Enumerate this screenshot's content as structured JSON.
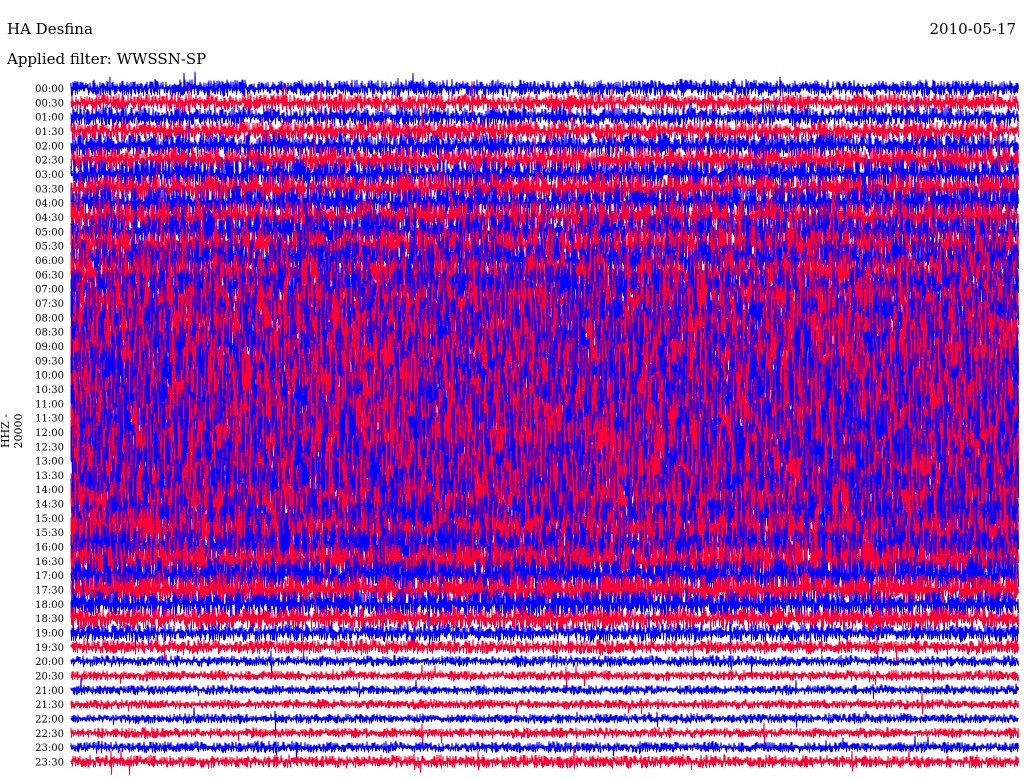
{
  "header": {
    "station": "HA Desfina",
    "filter": "Applied filter: WWSSN-SP",
    "date": "2010-05-17"
  },
  "chart_data": {
    "type": "line",
    "title": "HA Desfina",
    "subtitle": "Applied filter: WWSSN-SP",
    "ylabel": "HHZ - 20000",
    "xlabel": "",
    "row_minutes": 30,
    "colors": [
      "#0000ff",
      "#ff0033"
    ],
    "rows": [
      "00:00",
      "00:30",
      "01:00",
      "01:30",
      "02:00",
      "02:30",
      "03:00",
      "03:30",
      "04:00",
      "04:30",
      "05:00",
      "05:30",
      "06:00",
      "06:30",
      "07:00",
      "07:30",
      "08:00",
      "08:30",
      "09:00",
      "09:30",
      "10:00",
      "10:30",
      "11:00",
      "11:30",
      "12:00",
      "12:30",
      "13:00",
      "13:30",
      "14:00",
      "14:30",
      "15:00",
      "15:30",
      "16:00",
      "16:30",
      "17:00",
      "17:30",
      "18:00",
      "18:30",
      "19:00",
      "19:30",
      "20:00",
      "20:30",
      "21:00",
      "21:30",
      "22:00",
      "22:30",
      "23:00",
      "23:30"
    ],
    "relative_amplitude": [
      1.0,
      1.1,
      1.2,
      1.3,
      1.5,
      1.7,
      1.9,
      2.0,
      2.2,
      2.4,
      2.6,
      2.8,
      3.0,
      3.2,
      3.4,
      3.6,
      3.8,
      4.0,
      4.0,
      4.2,
      4.2,
      4.4,
      4.4,
      4.5,
      4.5,
      4.5,
      4.4,
      4.3,
      4.2,
      4.0,
      3.8,
      3.6,
      3.3,
      3.0,
      2.6,
      2.2,
      1.8,
      1.4,
      1.1,
      0.9,
      0.7,
      0.65,
      0.6,
      0.6,
      0.6,
      0.65,
      0.7,
      0.8
    ]
  }
}
